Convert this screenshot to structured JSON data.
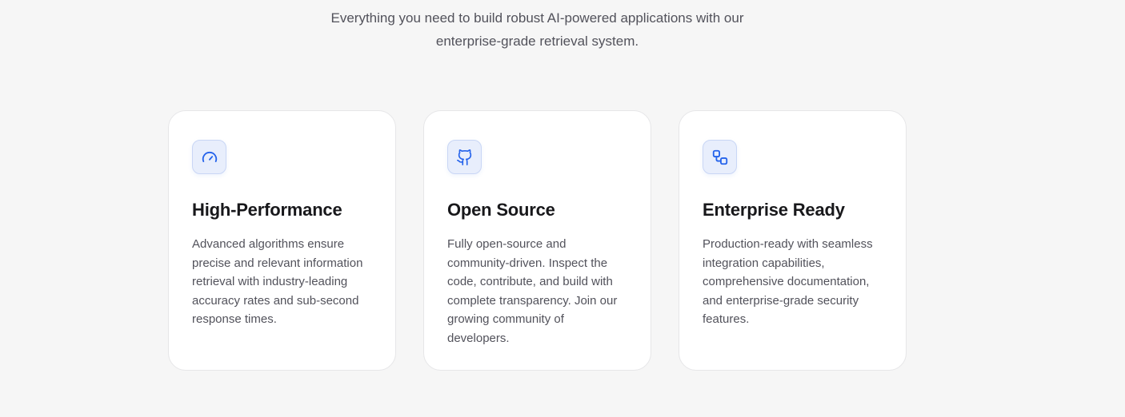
{
  "intro": {
    "line1": "Everything you need to build robust AI-powered applications with our",
    "line2": "enterprise-grade retrieval system."
  },
  "features": [
    {
      "icon": "gauge-icon",
      "title": "High-Performance",
      "description": "Advanced algorithms ensure precise and relevant information retrieval with industry-leading accuracy rates and sub-second response times."
    },
    {
      "icon": "github-icon",
      "title": "Open Source",
      "description": "Fully open-source and community-driven. Inspect the code, contribute, and build with complete transparency. Join our growing community of developers."
    },
    {
      "icon": "workflow-icon",
      "title": "Enterprise Ready",
      "description": "Production-ready with seamless integration capabilities, comprehensive documentation, and enterprise-grade security features."
    }
  ],
  "colors": {
    "accent": "#2563eb",
    "icon_bg": "#e8eefc",
    "background": "#f6f6f6",
    "card": "#ffffff",
    "text_muted": "#52525b"
  }
}
